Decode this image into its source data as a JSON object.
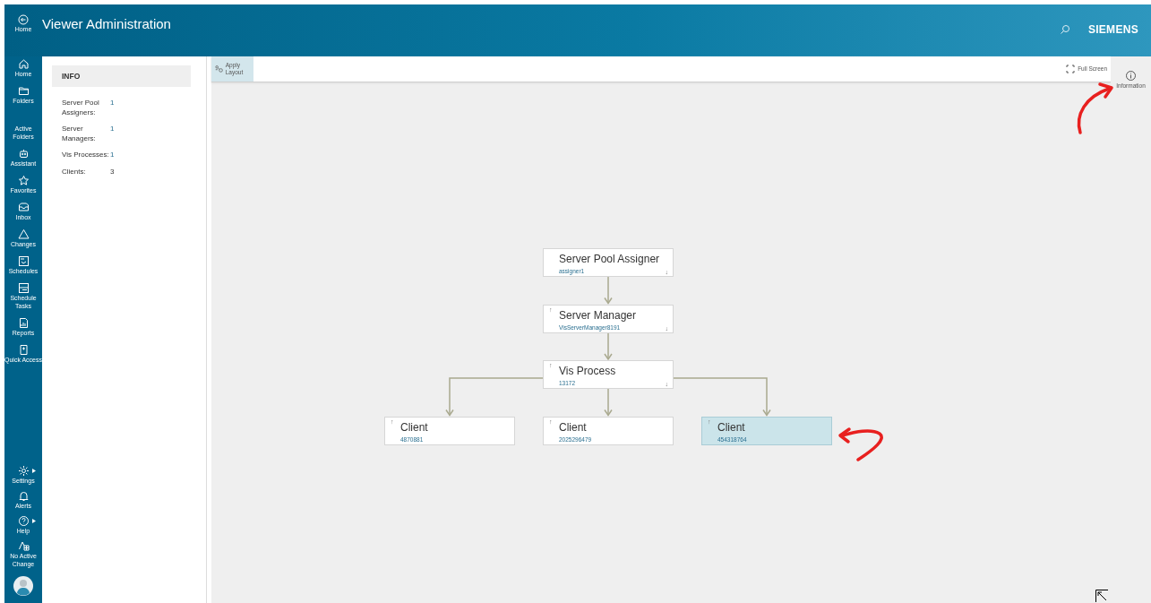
{
  "header": {
    "home_label": "Home",
    "title": "Viewer Administration",
    "brand": "SIEMENS"
  },
  "sidebar": {
    "items": [
      {
        "label": "Home",
        "has_submenu": false
      },
      {
        "label": "Folders",
        "has_submenu": false
      },
      {
        "label": "Active Folders",
        "has_submenu": false
      },
      {
        "label": "Assistant",
        "has_submenu": false
      },
      {
        "label": "Favorites",
        "has_submenu": false
      },
      {
        "label": "Inbox",
        "has_submenu": false
      },
      {
        "label": "Changes",
        "has_submenu": false
      },
      {
        "label": "Schedules",
        "has_submenu": false
      },
      {
        "label": "Schedule Tasks",
        "has_submenu": false
      },
      {
        "label": "Reports",
        "has_submenu": false
      },
      {
        "label": "Quick Access",
        "has_submenu": false
      }
    ],
    "bottom_items": [
      {
        "label": "Settings",
        "has_submenu": true
      },
      {
        "label": "Alerts",
        "has_submenu": false
      },
      {
        "label": "Help",
        "has_submenu": true
      },
      {
        "label": "No Active Change",
        "has_submenu": false
      }
    ]
  },
  "info": {
    "heading": "INFO",
    "rows": [
      {
        "label": "Server Pool Assigners:",
        "value": "1"
      },
      {
        "label": "Server Managers:",
        "value": "1"
      },
      {
        "label": "Vis Processes:",
        "value": "1"
      },
      {
        "label": "Clients:",
        "value": "3"
      }
    ]
  },
  "toolbar": {
    "apply_layout": "Apply Layout",
    "full_screen": "Full Screen"
  },
  "right_panel": {
    "information": "Information"
  },
  "diagram": {
    "root": {
      "title": "Server Pool Assigner",
      "subtitle": "assigner1",
      "down": "↓",
      "selected": false,
      "children": [
        {
          "title": "Server Manager",
          "subtitle": "VisServerManager8191",
          "up": "↑",
          "down": "↓",
          "selected": false,
          "children": [
            {
              "title": "Vis Process",
              "subtitle": "13172",
              "up": "↑",
              "down": "↓",
              "selected": false,
              "children": [
                {
                  "title": "Client",
                  "subtitle": "4870881",
                  "up": "↑",
                  "selected": false
                },
                {
                  "title": "Client",
                  "subtitle": "2025296479",
                  "up": "↑",
                  "selected": false
                },
                {
                  "title": "Client",
                  "subtitle": "454318764",
                  "up": "↑",
                  "selected": true
                }
              ]
            }
          ]
        }
      ]
    }
  }
}
